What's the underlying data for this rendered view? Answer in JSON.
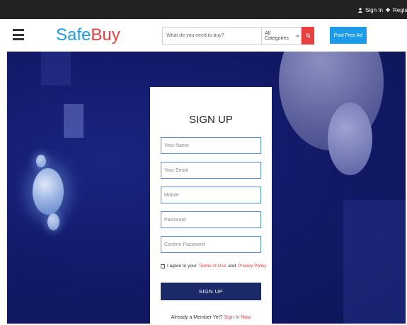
{
  "topbar": {
    "signin_label": "Sign In",
    "register_label": "Register"
  },
  "header": {
    "logo_part1": "Safe",
    "logo_part2": "Buy",
    "search_placeholder": "What do you need to buy?",
    "category_selected": "All Categories",
    "post_ad_label": "Post Free Ad"
  },
  "signup": {
    "title": "SIGN UP",
    "name_placeholder": "Your Name",
    "email_placeholder": "Your Email",
    "mobile_placeholder": "Mobile",
    "password_placeholder": "Password",
    "confirm_placeholder": "Confirm Password",
    "agree_prefix": "I agree to your",
    "terms_label": "Terms of Use",
    "and_label": "and",
    "privacy_label": "Privacy Policy",
    "button_label": "SIGN UP",
    "already_text": "Already a Member Yet?",
    "signin_link": "Sign In Now"
  },
  "colors": {
    "brand_blue": "#1e9be6",
    "brand_red": "#e8403f",
    "hero_navy": "#121a6a",
    "button_navy": "#1d2a6a",
    "topbar": "#222222"
  },
  "icons": [
    "user-icon",
    "plus-icon",
    "hamburger-icon",
    "chevron-down-icon",
    "search-icon"
  ]
}
